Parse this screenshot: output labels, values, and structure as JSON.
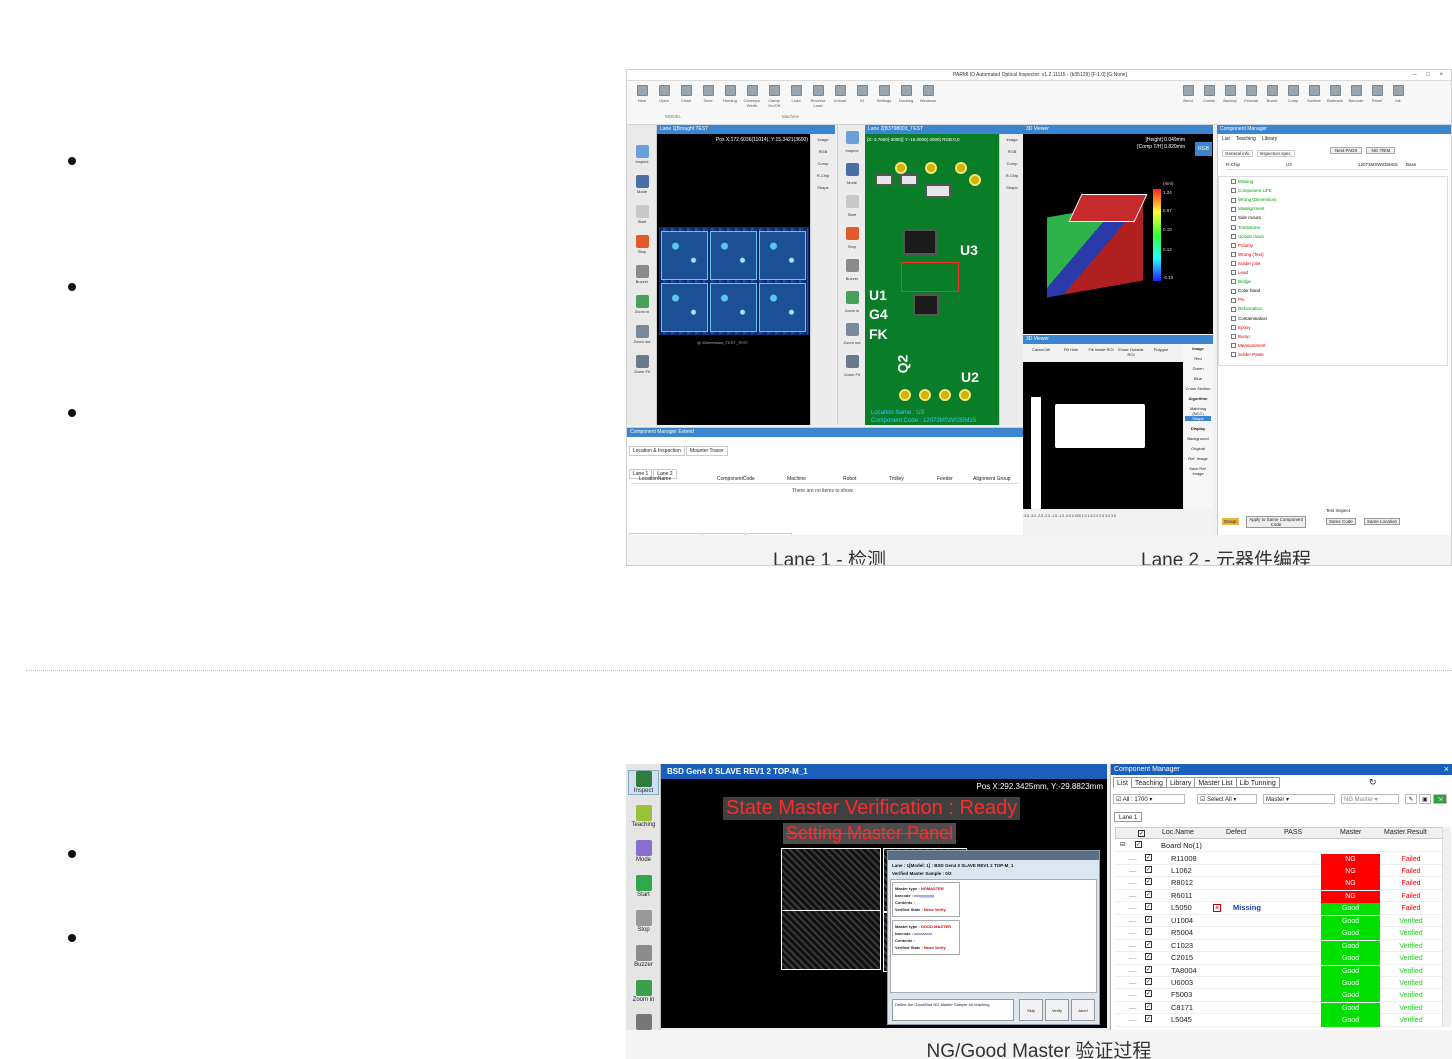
{
  "shot1": {
    "window_title": "PARMI ID Automated Optical Inspector: v1.2.11115 - (b35129) [F:1.0] [G:None]",
    "ribbon": {
      "model_buttons": [
        "New",
        "Open",
        "Close",
        "Save"
      ],
      "model_group": "MODEL",
      "machine_buttons": [
        "Homing",
        "Conveyor Width",
        "Clamp On/Off",
        "Load",
        "Reverse Load",
        "Unload"
      ],
      "machine_group": "Machine",
      "other_buttons": [
        "IO",
        "Settings",
        "Docking",
        "Windows"
      ],
      "right_buttons": [
        "Bend",
        "Create",
        "Backup",
        "Fiducial",
        "Board",
        "Comp",
        "Surface",
        "Badmark",
        "Barcode",
        "Panel",
        "Ink"
      ]
    },
    "left_tools": [
      "Inspect",
      "Mode",
      "Start",
      "Stop",
      "Buzzer",
      "Zoom in",
      "Zoom out",
      "Zoom Fit"
    ],
    "lane1": {
      "title": "Lane 1[Brought TEST",
      "pos": "Pos X:172.6036(11014), Y:15.3421(3600)",
      "caption_under_board": "@ 2Dimension_TEST_TEST"
    },
    "middle_tools": [
      "Image",
      "RGB",
      "Comp",
      "R-Chip",
      "Shape"
    ],
    "lane2": {
      "title": "Lane 2[B3798003_TEST",
      "pos_partial": "[X:-3.7600(-3000)] Y:-15.0000(-3000) RGB:0,0",
      "labels": [
        "U3",
        "U1",
        "G4",
        "FK",
        "Q2",
        "U2"
      ],
      "location_name": "Location Name : U3",
      "component_code": "Component Code : 12073MSW035M15"
    },
    "viewer3d": {
      "title": "3D Viewer",
      "height_info": "[Height] 0.049mm",
      "comp_info": "[Comp T/H] 0.820mm",
      "unit": "(mm)",
      "scale": [
        "1.24",
        "0.97",
        "0.10",
        "0.12",
        "-0.10"
      ],
      "rgb_label": "RGB",
      "view_buttons": [
        "B",
        "1:1",
        "L",
        "T",
        "R"
      ]
    },
    "viewer2": {
      "title": "3D Viewer",
      "tools": [
        "Cancel All",
        "Fill Hole",
        "Fill Inside ROI",
        "Erase Outside ROI",
        "Polygon"
      ],
      "image_tabs": [
        "Image",
        "Red",
        "Green",
        "Blue",
        "Cross Section"
      ],
      "algorithm_label": "Algorithm",
      "algorithm_items": [
        "Matching (NCC)",
        "Shape"
      ],
      "display_label": "Display",
      "display_items": [
        "Background",
        "Original",
        "Ref. Image",
        "Save Ref. Image"
      ],
      "axis": "-3.5 -3.0 -2.5 -2.0 -1.5 -1.0 -0.5 0.000 1.0 1.5 2.0 2.5 3.0 3.5"
    },
    "component_manager": {
      "title": "Component Manager",
      "tabs": [
        "List",
        "Teaching",
        "Library"
      ],
      "subtabs": [
        "General info",
        "Inspection spec."
      ],
      "toolbar": [
        "Next PADX",
        "NG ITEM"
      ],
      "row_header": [
        "R-Chip",
        "U3",
        "12073MSW035M15",
        "Base"
      ],
      "items": [
        {
          "label": "Missing",
          "color": "#00a000"
        },
        {
          "label": "Component LiFE",
          "color": "#00a000"
        },
        {
          "label": "Wrong (Dimension)",
          "color": "#00a000"
        },
        {
          "label": "Misalignment",
          "color": "#00a000"
        },
        {
          "label": "Side mount",
          "color": "#000000"
        },
        {
          "label": "Tombstone",
          "color": "#00a000"
        },
        {
          "label": "Upside down",
          "color": "#00a000"
        },
        {
          "label": "Polarity",
          "color": "#d40000"
        },
        {
          "label": "Wrong (Text)",
          "color": "#d40000"
        },
        {
          "label": "Solder joint",
          "color": "#d40000"
        },
        {
          "label": "Lead",
          "color": "#d40000"
        },
        {
          "label": "Bridge",
          "color": "#00a000"
        },
        {
          "label": "Color band",
          "color": "#000000"
        },
        {
          "label": "Pin",
          "color": "#d40000"
        },
        {
          "label": "Deformation",
          "color": "#00a000"
        },
        {
          "label": "Contamination",
          "color": "#000000"
        },
        {
          "label": "Epoxy",
          "color": "#d40000"
        },
        {
          "label": "Bump",
          "color": "#d40000"
        },
        {
          "label": "Measurement",
          "color": "#d40000"
        },
        {
          "label": "Solder Paste",
          "color": "#d40000"
        }
      ],
      "bottom_buttons": [
        "Group",
        "Apply to Same Component Code",
        "Same Code",
        "Same Location"
      ],
      "test_label": "Test Inspect"
    },
    "ext_panel": {
      "title": "Component Manager Extend",
      "tabs": [
        "Location & Inspection",
        "Mounter Tracer"
      ],
      "lane_tabs": [
        "Lane 1",
        "Lane 2"
      ],
      "columns": [
        "LocationName",
        "ComponentCode",
        "Machine",
        "Robot",
        "Trolley",
        "Feeder",
        "Alignment Group"
      ],
      "empty": "There are no items to show.",
      "bottom_tabs": [
        "Component Manager Extend",
        "Offset Cptr Tool",
        "Insp Result Chart"
      ]
    },
    "caption_left": "Lane 1 - 检测",
    "caption_right": "Lane 2 - 元器件编程"
  },
  "shot2": {
    "left_tools": [
      "Inspect",
      "Teaching",
      "Mode",
      "Start",
      "Stop",
      "Buzzer",
      "Zoom in"
    ],
    "header": "BSD Gen4 0 SLAVE REV1 2 TOP-M_1",
    "pos": "Pos X:292.3425mm, Y:-29.8823mm",
    "state_text": "State Master Verification : Ready",
    "setting_text": "Setting Master Panel",
    "dialog": {
      "lane_line": "Lane : 1[Model: 1] : BSD Gen4 0 SLAVE REV1 2 TOP-M_1",
      "sample_line": "Verified Master Sample : 0/2",
      "card1": {
        "type_label": "Master type :",
        "type_value": "NGMASTER",
        "barcode_label": "barcode :",
        "barcode_value": "xxxyyyyyyy",
        "contents_label": "Contents :",
        "state_label": "Verified State :",
        "state_value": "Need Verify"
      },
      "card2": {
        "type_label": "Master type :",
        "type_value": "GOOD MASTER",
        "barcode_label": "barcode :",
        "barcode_value": "xxxzzzzzz",
        "contents_label": "Contents :",
        "state_label": "Verified State :",
        "state_value": "Need Verify"
      },
      "note": "Define the Good/Bad NG Master Sample for teaching",
      "buttons": [
        "Skip",
        "Verify",
        "Abort"
      ]
    },
    "cm": {
      "title": "Component Manager",
      "close": "×",
      "tabs": [
        "List",
        "Teaching",
        "Library",
        "Master List",
        "Lib Tunning"
      ],
      "all_count": "All : 1700",
      "select_all": "Select All",
      "master_select": "Master",
      "ng_master_select": "NG Master",
      "lane_tab": "Lane 1",
      "columns": [
        "Loc.Name",
        "Defect",
        "PASS",
        "Master",
        "Master.Result"
      ],
      "board_row": "Board No(1)",
      "rows": [
        {
          "name": "R11008",
          "defect": "",
          "master": "NG",
          "result": "Failed"
        },
        {
          "name": "L1062",
          "defect": "",
          "master": "NG",
          "result": "Failed"
        },
        {
          "name": "R8012",
          "defect": "",
          "master": "NG",
          "result": "Failed"
        },
        {
          "name": "R6011",
          "defect": "",
          "master": "NG",
          "result": "Failed"
        },
        {
          "name": "L5050",
          "defect": "Missing",
          "master": "Good",
          "result": "Failed"
        },
        {
          "name": "U1004",
          "defect": "",
          "master": "Good",
          "result": "Verified"
        },
        {
          "name": "R5004",
          "defect": "",
          "master": "Good",
          "result": "Verified"
        },
        {
          "name": "C1023",
          "defect": "",
          "master": "Good",
          "result": "Verified"
        },
        {
          "name": "C2015",
          "defect": "",
          "master": "Good",
          "result": "Verified"
        },
        {
          "name": "TA8004",
          "defect": "",
          "master": "Good",
          "result": "Verified"
        },
        {
          "name": "U6003",
          "defect": "",
          "master": "Good",
          "result": "Verified"
        },
        {
          "name": "F5003",
          "defect": "",
          "master": "Good",
          "result": "Verified"
        },
        {
          "name": "C8171",
          "defect": "",
          "master": "Good",
          "result": "Verified"
        },
        {
          "name": "L5045",
          "defect": "",
          "master": "Good",
          "result": "Verified"
        }
      ]
    },
    "caption": "NG/Good Master 验证过程"
  },
  "colors": {
    "accent": "#3c86cf",
    "ng": "#ff0000",
    "good": "#00e000",
    "failed_text": "#ff0000",
    "verified_text": "#22cc22"
  }
}
